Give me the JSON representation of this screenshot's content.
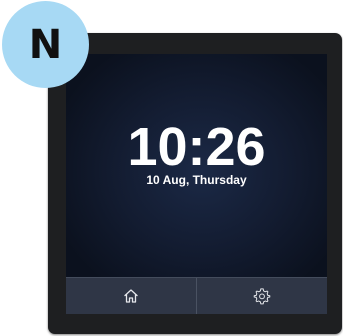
{
  "badge": {
    "letter": "N",
    "color": "#a7d9f4"
  },
  "clock": {
    "time": "10:26",
    "date": "10 Aug, Thursday"
  },
  "bottom_bar": {
    "buttons": [
      {
        "icon": "home-icon"
      },
      {
        "icon": "gear-icon"
      }
    ]
  },
  "colors": {
    "screen_bg": "#131c31",
    "bar_bg": "#2f3646",
    "bezel": "#1e1f21"
  }
}
